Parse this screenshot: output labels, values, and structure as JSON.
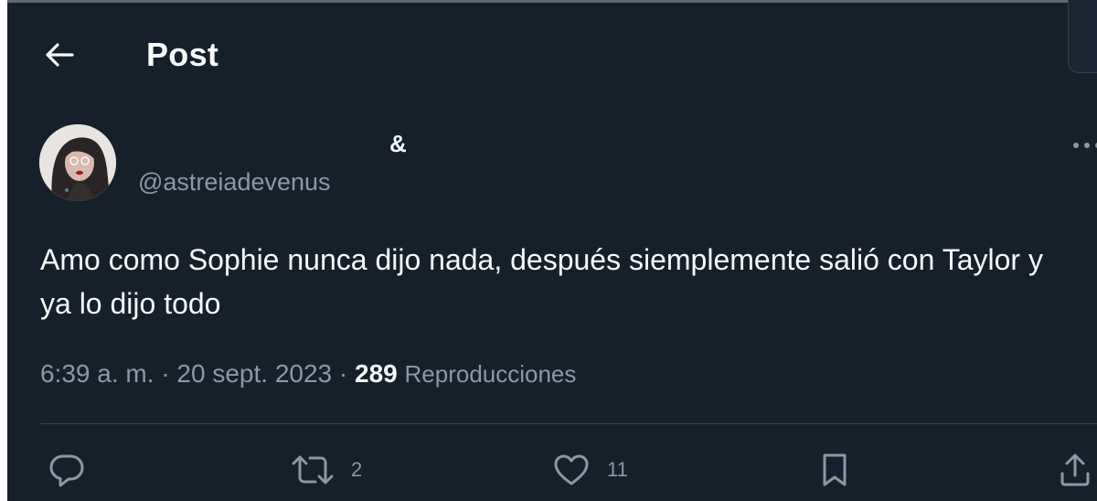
{
  "header": {
    "title": "Post"
  },
  "author": {
    "display_name": "&",
    "handle": "@astreiadevenus"
  },
  "post": {
    "text": "Amo como Sophie nunca dijo nada, después siemplemente salió con Taylor y ya lo dijo todo",
    "time": "6:39 a. m.",
    "separator1": " · ",
    "date": "20 sept. 2023",
    "separator2": " · ",
    "views": "289",
    "views_label": "Reproducciones"
  },
  "actions": {
    "reply_count": "",
    "repost_count": "2",
    "like_count": "11"
  },
  "colors": {
    "background": "#15202b",
    "text_primary": "#f7f9f9",
    "text_secondary": "#8b98a5",
    "divider": "#38444d"
  },
  "icons": {
    "back": "arrow-left-icon",
    "more": "more-dots-icon",
    "reply": "reply-bubble-icon",
    "repost": "repost-icon",
    "like": "heart-icon",
    "bookmark": "bookmark-icon",
    "share": "share-icon"
  }
}
